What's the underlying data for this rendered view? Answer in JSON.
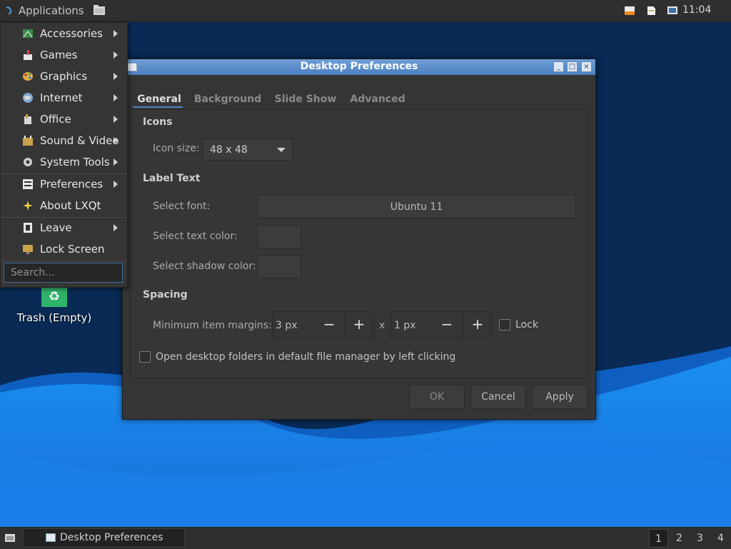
{
  "top_panel": {
    "app_menu_label": "Applications",
    "clock": "11:04"
  },
  "app_menu": {
    "items": [
      {
        "label": "Accessories",
        "icon": "accessories-icon",
        "submenu": true
      },
      {
        "label": "Games",
        "icon": "games-icon",
        "submenu": true
      },
      {
        "label": "Graphics",
        "icon": "graphics-icon",
        "submenu": true
      },
      {
        "label": "Internet",
        "icon": "internet-icon",
        "submenu": true
      },
      {
        "label": "Office",
        "icon": "office-icon",
        "submenu": true
      },
      {
        "label": "Sound & Video",
        "icon": "sound-video-icon",
        "submenu": true
      },
      {
        "label": "System Tools",
        "icon": "gear-icon",
        "submenu": true
      },
      {
        "label": "Preferences",
        "icon": "preferences-icon",
        "submenu": true
      },
      {
        "label": "About LXQt",
        "icon": "star-icon",
        "submenu": false
      },
      {
        "label": "Leave",
        "icon": "leave-icon",
        "submenu": true
      },
      {
        "label": "Lock Screen",
        "icon": "lock-screen-icon",
        "submenu": false
      }
    ],
    "search_placeholder": "Search..."
  },
  "desktop": {
    "trash_label": "Trash (Empty)"
  },
  "dialog": {
    "title": "Desktop Preferences",
    "tabs": [
      "General",
      "Background",
      "Slide Show",
      "Advanced"
    ],
    "active_tab": "General",
    "icons_section": "Icons",
    "icon_size_label": "Icon size:",
    "icon_size_value": "48 x 48",
    "label_text_section": "Label Text",
    "select_font_label": "Select font:",
    "font_value": "Ubuntu 11",
    "text_color_label": "Select text color:",
    "shadow_color_label": "Select shadow color:",
    "spacing_section": "Spacing",
    "min_margins_label": "Minimum item margins:",
    "margin_x": "3 px",
    "margin_y": "1 px",
    "times": "x",
    "minus": "−",
    "plus": "+",
    "lock_label": "Lock",
    "lock_checked": false,
    "open_folders_label": "Open desktop folders in default file manager by left clicking",
    "open_folders_checked": false,
    "ok": "OK",
    "cancel": "Cancel",
    "apply": "Apply"
  },
  "taskbar": {
    "task_label": "Desktop Preferences",
    "workspaces": [
      "1",
      "2",
      "3",
      "4"
    ],
    "active_workspace": "1"
  },
  "colors": {
    "accent": "#4a86c8",
    "desktop_dark": "#082a55",
    "wave": "#1e90f0"
  }
}
